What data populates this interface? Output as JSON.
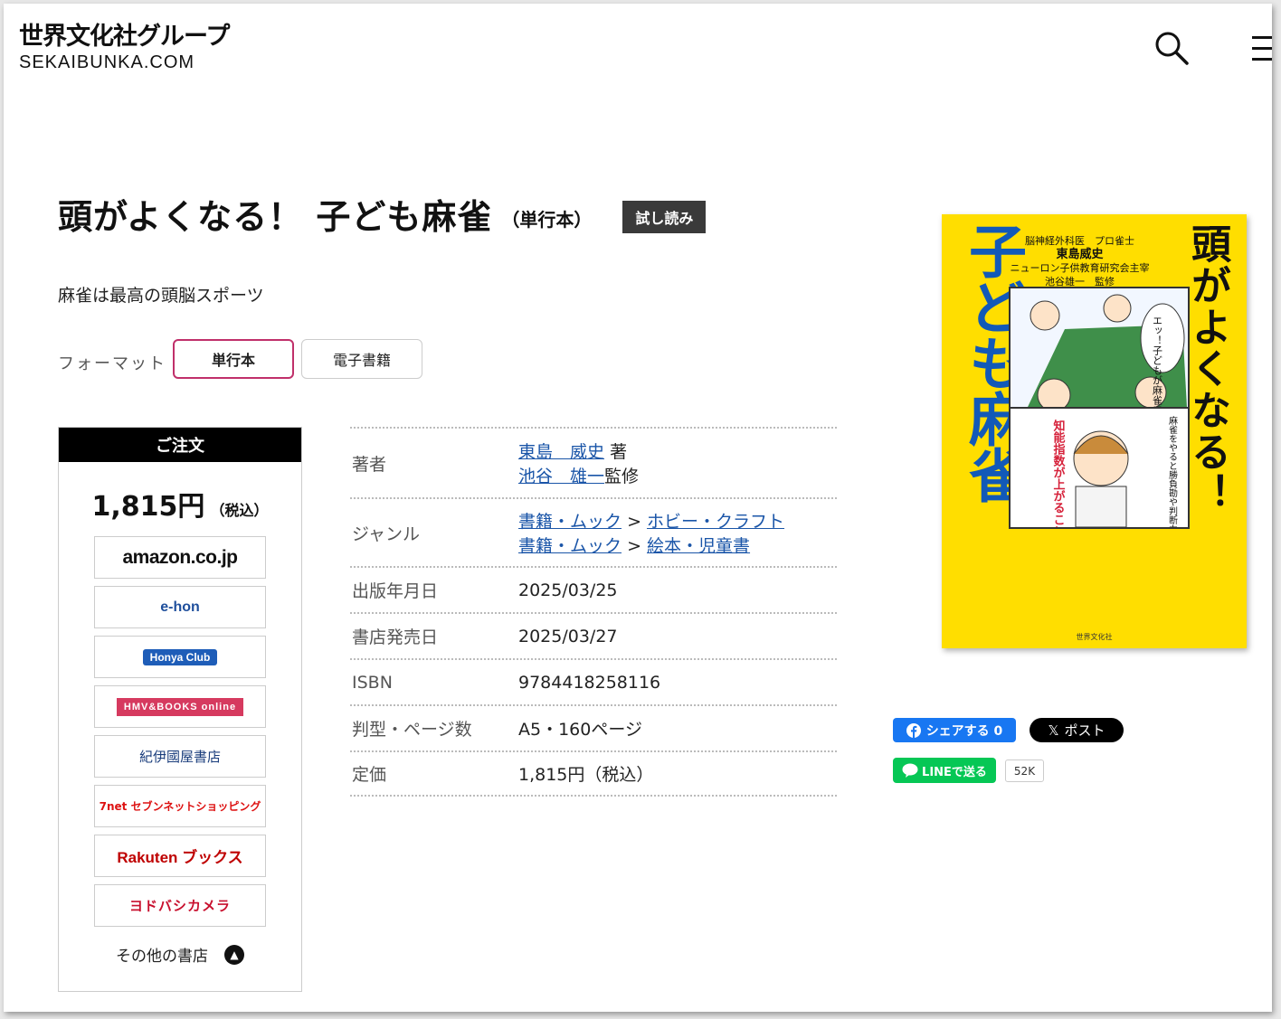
{
  "header": {
    "logo_jp": "世界文化社グループ",
    "logo_en": "SEKAIBUNKA.COM",
    "search_icon": "search-icon",
    "menu_icon": "hamburger-menu-icon"
  },
  "book": {
    "title": "頭がよくなる！ 子ども麻雀",
    "format_tag": "（単行本）",
    "trial_label": "試し読み",
    "catch_copy": "麻雀は最高の頭脳スポーツ"
  },
  "format": {
    "label": "フォーマット",
    "options": [
      "単行本",
      "電子書籍"
    ],
    "selected": "単行本"
  },
  "order": {
    "header": "ご注文",
    "price": "1,815円",
    "tax": "（税込）",
    "shops": [
      {
        "name": "amazon.co.jp"
      },
      {
        "name": "e-hon"
      },
      {
        "name": "Honya Club"
      },
      {
        "name": "HMV&BOOKS online"
      },
      {
        "name": "紀伊國屋書店"
      },
      {
        "name": "7net セブンネットショッピング"
      },
      {
        "name": "Rakuten ブックス"
      },
      {
        "name": "ヨドバシカメラ"
      }
    ],
    "more_shops": "その他の書店"
  },
  "details": {
    "author_label": "著者",
    "author1_name": "東島　威史",
    "author1_role": "著",
    "author2_name": "池谷　雄一",
    "author2_role": "監修",
    "genre_label": "ジャンル",
    "genre1_a": "書籍・ムック",
    "genre1_b": "ホビー・クラフト",
    "genre2_a": "書籍・ムック",
    "genre2_b": "絵本・児童書",
    "genre_sep": ">",
    "pub_date_label": "出版年月日",
    "pub_date": "2025/03/25",
    "store_date_label": "書店発売日",
    "store_date": "2025/03/27",
    "isbn_label": "ISBN",
    "isbn": "9784418258116",
    "size_label": "判型・ページ数",
    "size": "A5・160ページ",
    "price_label": "定価",
    "price": "1,815円（税込）"
  },
  "cover": {
    "title": "頭がよくなる！",
    "subtitle": "子ども麻雀",
    "author_line1": "脳神経外科医　プロ雀士",
    "author_name": "東島威史",
    "author_line2": "ニューロン子供教育研究会主宰",
    "supervisor": "池谷雄一　監修",
    "bubble1": "エッ！子どもが麻雀!?",
    "bubble2": "麻雀をやると勝負勘や判断力が鍛えられて",
    "bubble3": "知能指数が上がることがわかっています",
    "publisher": "世界文化社"
  },
  "share": {
    "facebook_label": "シェアする 0",
    "x_label": "ポスト",
    "line_label": "LINEで送る",
    "line_count": "52K"
  },
  "colors": {
    "accent": "#c0306a",
    "link": "#1a55a8",
    "cover_yellow": "#ffde00",
    "cover_blue": "#1259b8"
  }
}
